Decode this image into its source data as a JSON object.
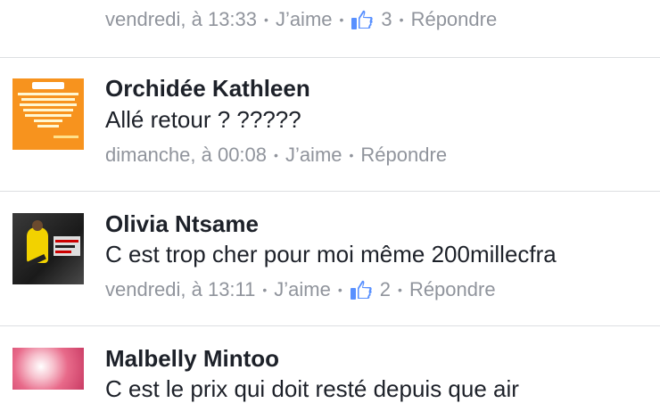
{
  "comment0": {
    "time": "vendredi, à 13:33",
    "like": "J’aime",
    "count": "3",
    "reply": "Répondre"
  },
  "comment1": {
    "name": "Orchidée Kathleen",
    "text": "Allé retour ? ?????",
    "time": "dimanche, à 00:08",
    "like": "J’aime",
    "reply": "Répondre",
    "avatar_color": "#f7931e"
  },
  "comment2": {
    "name": "Olivia Ntsame",
    "text": "C est trop cher pour moi même 200millecfra",
    "time": "vendredi, à 13:11",
    "like": "J’aime",
    "count": "2",
    "reply": "Répondre"
  },
  "comment3": {
    "name": "Malbelly Mintoo",
    "text": "C est le prix qui doit resté depuis que air"
  },
  "colors": {
    "meta": "#90949c",
    "like_blue": "#5890ff",
    "divider": "#dddfe2"
  }
}
